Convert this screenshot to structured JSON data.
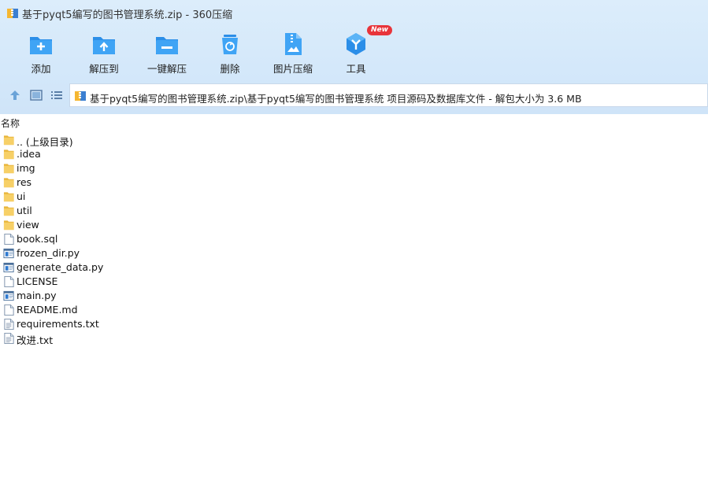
{
  "window": {
    "title": "基于pyqt5编写的图书管理系统.zip - 360压缩"
  },
  "toolbar": {
    "items": [
      {
        "label": "添加",
        "icon": "add-folder-icon"
      },
      {
        "label": "解压到",
        "icon": "extract-to-icon"
      },
      {
        "label": "一键解压",
        "icon": "one-click-extract-icon"
      },
      {
        "label": "删除",
        "icon": "delete-bin-icon"
      },
      {
        "label": "图片压缩",
        "icon": "image-compress-icon"
      },
      {
        "label": "工具",
        "icon": "tools-icon",
        "badge": "New"
      }
    ]
  },
  "address": {
    "path": "基于pyqt5编写的图书管理系统.zip\\基于pyqt5编写的图书管理系统 项目源码及数据库文件 - 解包大小为 3.6 MB"
  },
  "list": {
    "column_name": "名称",
    "items": [
      {
        "name": ".. (上级目录)",
        "type": "folder"
      },
      {
        "name": ".idea",
        "type": "folder"
      },
      {
        "name": "img",
        "type": "folder"
      },
      {
        "name": "res",
        "type": "folder"
      },
      {
        "name": "ui",
        "type": "folder"
      },
      {
        "name": "util",
        "type": "folder"
      },
      {
        "name": "view",
        "type": "folder"
      },
      {
        "name": "book.sql",
        "type": "file"
      },
      {
        "name": "frozen_dir.py",
        "type": "py"
      },
      {
        "name": "generate_data.py",
        "type": "py"
      },
      {
        "name": "LICENSE",
        "type": "file"
      },
      {
        "name": "main.py",
        "type": "py"
      },
      {
        "name": "README.md",
        "type": "file"
      },
      {
        "name": "requirements.txt",
        "type": "txt"
      },
      {
        "name": "改进.txt",
        "type": "txt"
      }
    ]
  },
  "colors": {
    "accent": "#1e90e8",
    "folder": "#f7d067",
    "badge": "#e8343a"
  }
}
